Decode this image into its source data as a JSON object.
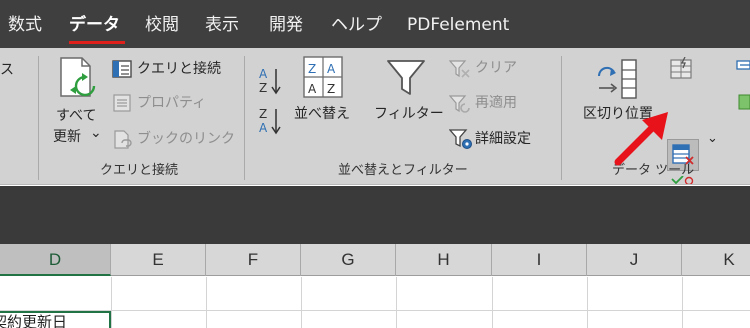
{
  "tabs": [
    {
      "label": "数式"
    },
    {
      "label": "データ"
    },
    {
      "label": "校閲"
    },
    {
      "label": "表示"
    },
    {
      "label": "開発"
    },
    {
      "label": "ヘルプ"
    },
    {
      "label": "PDFelement"
    }
  ],
  "ribbon": {
    "left_cut_label": "ス",
    "queries_group": {
      "refresh_all_line1": "すべて",
      "refresh_all_line2": "更新",
      "refresh_chevron": "⌄",
      "queries_connections": "クエリと接続",
      "properties": "プロパティ",
      "edit_links": "ブックのリンク",
      "group_label": "クエリと接続"
    },
    "sort_filter_group": {
      "sort": "並べ替え",
      "filter": "フィルター",
      "clear": "クリア",
      "reapply": "再適用",
      "advanced": "詳細設定",
      "group_label": "並べ替えとフィルター"
    },
    "data_tools_group": {
      "text_to_columns": "区切り位置",
      "more_chevron": "⌄",
      "group_label": "データ ツール"
    }
  },
  "columns": [
    "D",
    "E",
    "F",
    "G",
    "H",
    "I",
    "J",
    "K"
  ],
  "cells": {
    "d2": "契約更新日"
  },
  "colors": {
    "tabbar_bg": "#3f3f3f",
    "ribbon_bg": "#d2d2d2",
    "accent_red": "#e0201b",
    "excel_green": "#217346",
    "arrow_red": "#e8121b"
  },
  "icons": [
    "refresh-all-icon",
    "queries-connections-icon",
    "properties-icon",
    "edit-links-icon",
    "sort-az-icon",
    "sort-za-icon",
    "sort-icon",
    "filter-icon",
    "clear-filter-icon",
    "reapply-icon",
    "advanced-filter-icon",
    "text-to-columns-icon",
    "flash-fill-icon",
    "remove-duplicates-icon",
    "data-validation-icon",
    "red-arrow-annotation"
  ]
}
